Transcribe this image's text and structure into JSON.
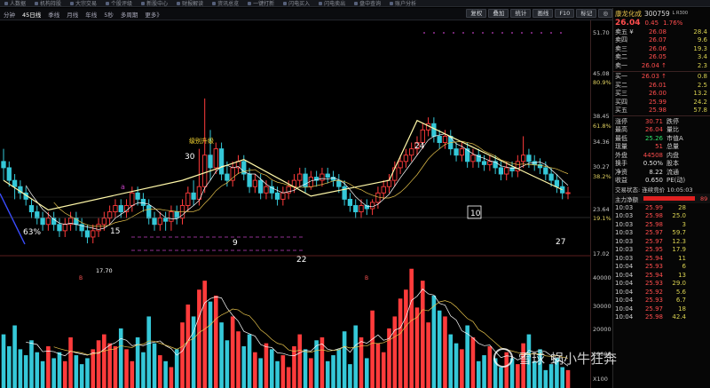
{
  "topbar": {
    "items": [
      "人数据",
      "机构持股",
      "大宗交易",
      "个股评级",
      "新股中心",
      "财报解读",
      "资讯总览",
      "一键打新",
      "闪电买入",
      "闪电卖出",
      "盘中查询",
      "账户分析"
    ]
  },
  "toolbar": {
    "timeframes": [
      "分钟",
      "45日线",
      "季线",
      "月线",
      "年线",
      "5秒",
      "多周期",
      "更多》"
    ],
    "active_timeframe": "45日线",
    "controls": [
      "复权",
      "叠加",
      "统计",
      "画线",
      "F10",
      "标记",
      "◎"
    ]
  },
  "price_axis": {
    "labels": [
      "51.70",
      "45.08",
      "80.9%",
      "38.45",
      "61.8%",
      "34.36",
      "30.27",
      "38.2%",
      "23.64",
      "19.1%",
      "17.02",
      "40000",
      "30000",
      "20000",
      "10000",
      "X100"
    ]
  },
  "chart_labels": {
    "pct63": "63%",
    "n15": "15",
    "n30": "30",
    "n9": "9",
    "n22": "22",
    "n24": "24",
    "n10": "10",
    "n27": "27",
    "upgrade": "级别升级",
    "low_price": "17.70",
    "a": "a",
    "b1": "B",
    "b2": "B"
  },
  "chart_data": {
    "type": "candlestick",
    "ylim": [
      17.02,
      51.7
    ],
    "candles": [
      [
        31,
        30,
        33,
        28
      ],
      [
        30,
        28,
        31,
        27
      ],
      [
        28,
        27,
        29,
        25
      ],
      [
        27,
        26,
        28,
        25
      ],
      [
        26,
        25,
        27,
        24
      ],
      [
        24,
        23,
        25,
        22
      ],
      [
        23,
        22,
        24,
        21
      ],
      [
        22,
        21,
        23,
        20
      ],
      [
        21,
        22,
        23,
        20
      ],
      [
        22,
        21,
        23,
        20
      ],
      [
        21,
        20,
        22,
        19
      ],
      [
        20,
        21,
        22,
        19
      ],
      [
        21,
        22,
        23,
        20
      ],
      [
        22,
        21,
        23,
        20
      ],
      [
        21,
        20,
        22,
        19
      ],
      [
        20,
        19,
        21,
        18
      ],
      [
        19,
        20,
        21,
        18
      ],
      [
        20,
        21,
        22,
        19
      ],
      [
        21,
        22,
        23,
        20
      ],
      [
        22,
        23,
        24,
        21
      ],
      [
        23,
        24,
        25,
        22
      ],
      [
        24,
        23,
        25,
        22
      ],
      [
        23,
        24,
        25,
        22
      ],
      [
        24,
        26,
        27,
        23
      ],
      [
        26,
        25,
        27,
        24
      ],
      [
        25,
        24,
        26,
        23
      ],
      [
        24,
        22,
        25,
        21
      ],
      [
        22,
        21,
        23,
        20
      ],
      [
        21,
        22,
        23,
        20
      ],
      [
        22,
        21.5,
        23,
        20
      ],
      [
        21.5,
        23,
        24,
        20
      ],
      [
        23,
        22,
        24,
        21
      ],
      [
        22,
        24,
        25,
        21
      ],
      [
        24,
        26,
        27,
        23
      ],
      [
        26,
        25,
        28,
        24
      ],
      [
        25,
        27,
        33,
        24
      ],
      [
        27,
        32,
        41,
        26
      ],
      [
        32,
        30,
        36,
        28
      ],
      [
        30,
        33,
        34,
        29
      ],
      [
        33,
        29,
        34,
        28
      ],
      [
        29,
        28,
        31,
        27
      ],
      [
        28,
        30,
        31,
        27
      ],
      [
        30,
        31,
        32,
        29
      ],
      [
        31,
        29,
        32,
        28
      ],
      [
        29,
        27,
        30,
        26
      ],
      [
        27,
        28,
        29,
        26
      ],
      [
        28,
        26,
        29,
        25
      ],
      [
        26,
        27,
        28,
        25
      ],
      [
        27,
        26,
        28,
        25
      ],
      [
        26,
        25,
        27,
        24
      ],
      [
        25,
        26,
        27,
        24
      ],
      [
        26,
        27,
        28,
        25
      ],
      [
        27,
        28,
        29,
        26
      ],
      [
        28,
        29,
        30,
        27
      ],
      [
        29,
        27,
        30,
        26
      ],
      [
        27,
        28.5,
        29.5,
        26.5
      ],
      [
        28.5,
        28,
        29.5,
        27
      ],
      [
        28,
        29,
        30,
        27
      ],
      [
        29,
        28.5,
        30,
        27.5
      ],
      [
        28.5,
        28,
        29.5,
        27
      ],
      [
        28,
        27,
        29,
        26
      ],
      [
        27,
        25,
        28,
        24
      ],
      [
        25,
        24,
        26,
        23
      ],
      [
        24,
        23,
        25,
        22
      ],
      [
        23,
        24,
        25,
        22
      ],
      [
        24,
        23.5,
        25,
        22.5
      ],
      [
        23.5,
        24.5,
        25,
        22.5
      ],
      [
        24.5,
        26,
        27,
        23.5
      ],
      [
        26,
        27,
        28,
        25
      ],
      [
        27,
        28,
        29,
        26
      ],
      [
        28,
        30,
        31,
        27
      ],
      [
        30,
        31,
        32,
        29
      ],
      [
        31,
        32,
        33,
        30
      ],
      [
        32,
        33,
        34,
        31
      ],
      [
        33,
        34,
        35,
        32
      ],
      [
        34,
        36,
        37,
        33
      ],
      [
        36,
        37,
        38,
        35
      ],
      [
        37,
        35,
        38,
        34
      ],
      [
        35,
        34,
        36,
        33
      ],
      [
        34,
        35,
        36,
        33
      ],
      [
        35,
        33,
        36,
        32
      ],
      [
        33,
        32,
        34,
        31
      ],
      [
        32,
        33,
        34,
        31
      ],
      [
        33,
        31,
        34,
        30
      ],
      [
        31,
        32,
        33,
        30
      ],
      [
        32,
        31,
        33,
        30
      ],
      [
        31,
        30.5,
        32,
        29.5
      ],
      [
        30.5,
        31,
        32,
        29.5
      ],
      [
        31,
        30,
        32,
        29
      ],
      [
        30,
        29,
        31,
        28
      ],
      [
        29,
        30,
        31,
        28
      ],
      [
        30,
        29.5,
        31,
        28.5
      ],
      [
        29.5,
        31,
        32,
        28.5
      ],
      [
        31,
        32,
        35,
        30
      ],
      [
        32,
        31,
        33,
        30
      ],
      [
        31,
        30.5,
        32,
        29.5
      ],
      [
        30.5,
        30,
        31.5,
        29
      ],
      [
        30,
        29,
        31,
        28
      ],
      [
        29,
        28,
        30,
        27
      ],
      [
        28,
        27,
        29,
        26
      ],
      [
        27,
        26,
        28,
        25
      ],
      [
        26,
        26.04,
        27,
        25
      ]
    ],
    "volumes": [
      18000,
      14000,
      21000,
      13000,
      11000,
      16000,
      12000,
      9000,
      14000,
      10000,
      12000,
      9000,
      17000,
      11000,
      8000,
      10000,
      13000,
      16000,
      18000,
      15000,
      14000,
      20000,
      13000,
      9000,
      17000,
      12000,
      24000,
      15000,
      11000,
      9000,
      7000,
      13000,
      22000,
      28000,
      24000,
      33000,
      36000,
      29000,
      31000,
      22000,
      16000,
      24000,
      19000,
      14000,
      18000,
      12000,
      10000,
      15000,
      13000,
      9000,
      11000,
      7000,
      14000,
      18000,
      13000,
      10000,
      16000,
      17000,
      9000,
      11000,
      13000,
      19000,
      8000,
      21000,
      17000,
      10000,
      26000,
      15000,
      12000,
      20000,
      24000,
      30000,
      33000,
      40000,
      27000,
      36000,
      22000,
      31000,
      26000,
      24000,
      18000,
      15000,
      13000,
      21000,
      17000,
      9000,
      11000,
      14000,
      10000,
      7000,
      12000,
      10000,
      8000,
      15000,
      18000,
      9000,
      13000,
      6000,
      8000,
      10000,
      7000,
      6000
    ],
    "vol_ylim": [
      0,
      42000
    ],
    "zigzag": [
      [
        "base",
        0
      ],
      [
        "low",
        6.5
      ],
      [
        "high",
        40
      ],
      [
        "low",
        22
      ],
      [
        "high",
        37
      ],
      [
        "low",
        25.5
      ]
    ]
  },
  "panel": {
    "name": "康龙化成",
    "code": "300759",
    "tag": "L R300",
    "price": "26.04",
    "change": "0.45",
    "pct": "1.76%",
    "asks": [
      {
        "label": "卖五 ¥",
        "price": "26.08",
        "vol": "28.4"
      },
      {
        "label": "卖四",
        "price": "26.07",
        "vol": "9.6"
      },
      {
        "label": "卖三",
        "price": "26.06",
        "vol": "19.3"
      },
      {
        "label": "卖二",
        "price": "26.05",
        "vol": "3.4"
      },
      {
        "label": "卖一",
        "price": "26.04 ↑",
        "vol": "2.3"
      }
    ],
    "bids": [
      {
        "label": "买一",
        "price": "26.03 ↑",
        "vol": "0.8"
      },
      {
        "label": "买二",
        "price": "26.01",
        "vol": "2.5"
      },
      {
        "label": "买三",
        "price": "26.00",
        "vol": "13.2"
      },
      {
        "label": "买四",
        "price": "25.99",
        "vol": "24.2"
      },
      {
        "label": "买五",
        "price": "25.98",
        "vol": "57.8"
      }
    ],
    "stats": [
      {
        "a": "涨停",
        "b": "30.71",
        "c": "跌停",
        "d": ""
      },
      {
        "a": "最高",
        "b": "26.04",
        "c": "量比",
        "d": ""
      },
      {
        "a": "最低",
        "b": "25.26",
        "c": "市值A",
        "d": ""
      },
      {
        "a": "现量",
        "b": "51",
        "c": "总量",
        "d": ""
      },
      {
        "a": "外盘",
        "b": "44508",
        "c": "内盘",
        "d": ""
      },
      {
        "a": "换手",
        "b": "0.50%",
        "c": "股本",
        "d": ""
      },
      {
        "a": "净资",
        "b": "8.22",
        "c": "流通",
        "d": ""
      },
      {
        "a": "收益",
        "b": "0.650",
        "c": "PE(动)",
        "d": ""
      }
    ],
    "trade_status": "交易状态: 连续竞价 10:05:03",
    "main_flow_label": "主力净额",
    "main_flow_pct": "89",
    "ticks": [
      {
        "t": "10:03",
        "p": "25.99",
        "v": "28"
      },
      {
        "t": "10:03",
        "p": "25.98",
        "v": "25.0"
      },
      {
        "t": "10:03",
        "p": "25.98",
        "v": "3"
      },
      {
        "t": "10:03",
        "p": "25.97",
        "v": "59.7"
      },
      {
        "t": "10:03",
        "p": "25.97",
        "v": "12.3"
      },
      {
        "t": "10:03",
        "p": "25.95",
        "v": "17.9"
      },
      {
        "t": "10:03",
        "p": "25.94",
        "v": "11"
      },
      {
        "t": "10:04",
        "p": "25.93",
        "v": "6"
      },
      {
        "t": "10:04",
        "p": "25.94",
        "v": "13"
      },
      {
        "t": "10:04",
        "p": "25.93",
        "v": "29.0"
      },
      {
        "t": "10:04",
        "p": "25.92",
        "v": "5.6"
      },
      {
        "t": "10:04",
        "p": "25.93",
        "v": "6.7"
      },
      {
        "t": "10:04",
        "p": "25.97",
        "v": "18"
      },
      {
        "t": "10:04",
        "p": "25.98",
        "v": "42.4"
      }
    ]
  },
  "watermark": {
    "site": "雪球",
    "author": "蜗小牛狂奔"
  }
}
